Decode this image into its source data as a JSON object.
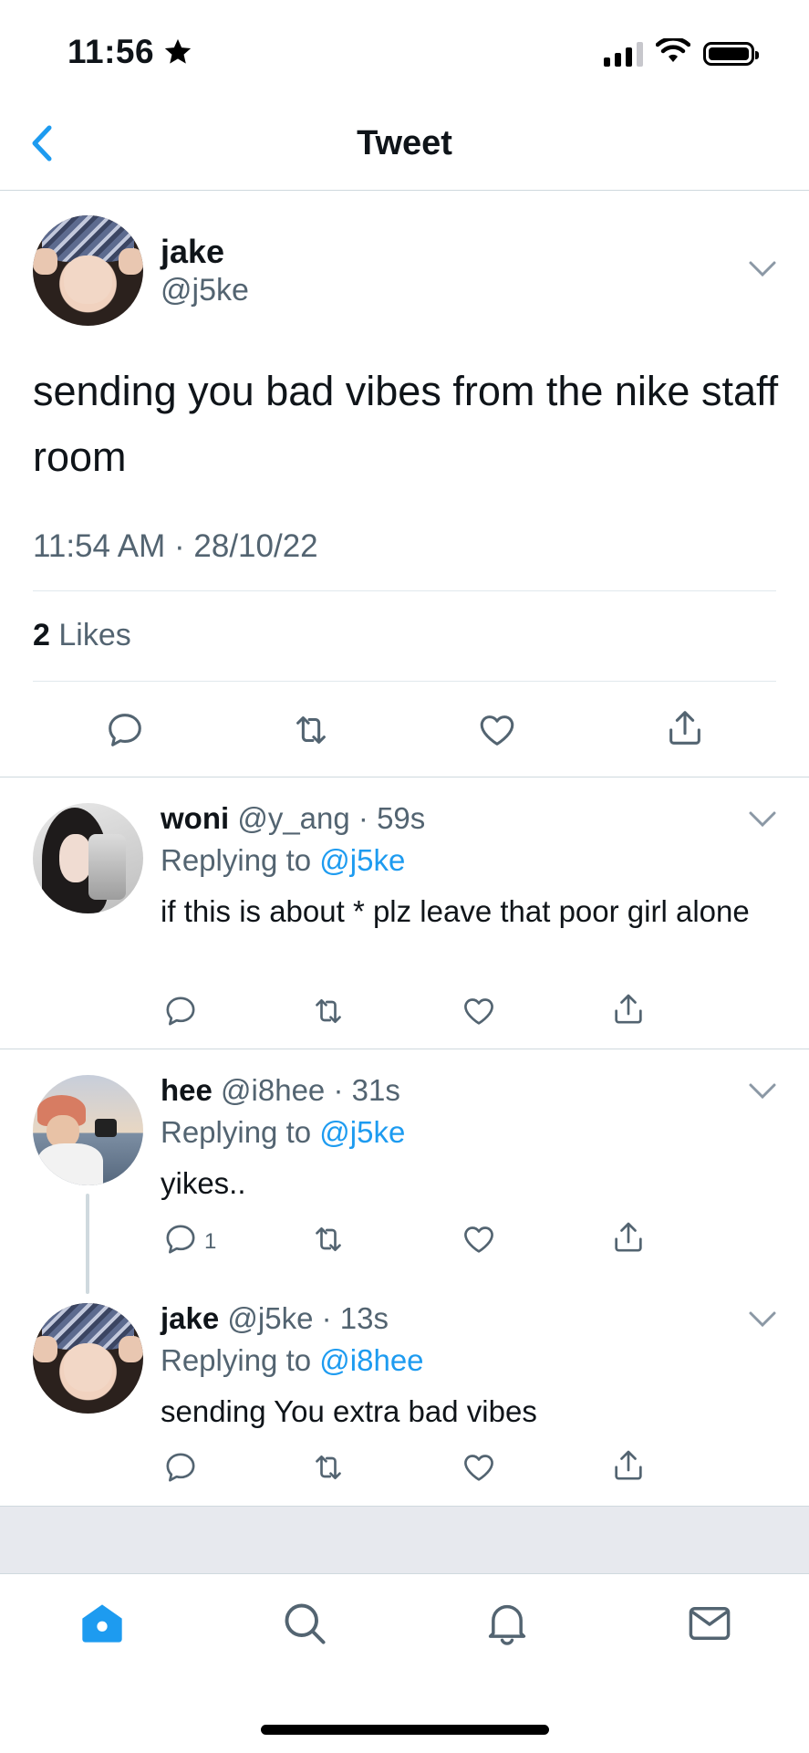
{
  "status_bar": {
    "time": "11:56"
  },
  "nav": {
    "title": "Tweet"
  },
  "main_tweet": {
    "name": "jake",
    "handle": "@j5ke",
    "text": "sending you bad vibes from the nike staff room",
    "timestamp": "11:54 AM · 28/10/22",
    "likes_count": "2",
    "likes_label": "Likes"
  },
  "replies": [
    {
      "name": "woni",
      "handle_time": "@y_ang · 59s",
      "replying_prefix": "Replying to",
      "replying_to": "@j5ke",
      "text": "if this is about * plz leave that poor girl alone",
      "reply_count": ""
    },
    {
      "name": "hee",
      "handle_time": "@i8hee · 31s",
      "replying_prefix": "Replying to",
      "replying_to": "@j5ke",
      "text": "yikes..",
      "reply_count": "1"
    },
    {
      "name": "jake",
      "handle_time": "@j5ke · 13s",
      "replying_prefix": "Replying to",
      "replying_to": "@i8hee",
      "text": "sending You extra bad vibes",
      "reply_count": ""
    }
  ],
  "tab_bar": {
    "items": [
      "home-icon",
      "search-icon",
      "notifications-bell-icon",
      "messages-envelope-icon"
    ],
    "active": "home-icon"
  },
  "colors": {
    "accent": "#1d9bf0",
    "secondary_text": "#536471",
    "primary_text": "#0f1419",
    "divider": "#cfd9de"
  }
}
